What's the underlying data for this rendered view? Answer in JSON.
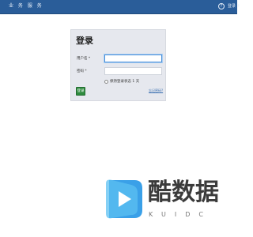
{
  "header": {
    "brand": "业 务 服 务",
    "help_icon_glyph": "?",
    "login_link": "登录 ↑"
  },
  "login": {
    "title": "登录",
    "username_label": "用户名 *",
    "username_value": "",
    "password_label": "密码 *",
    "password_value": "",
    "remember_label": "保持登录状态 1 天",
    "remember_checked": false,
    "submit_label": "登录",
    "forgot_link": "忘记密码?"
  },
  "watermark": {
    "text": "酷数据",
    "sub": "KUIDC"
  },
  "colors": {
    "topbar": "#2a5d99",
    "card": "#e6e8ee",
    "button": "#2e8b3e",
    "focus": "#4a90d9",
    "watermark_blue": "#3aa0e8"
  }
}
